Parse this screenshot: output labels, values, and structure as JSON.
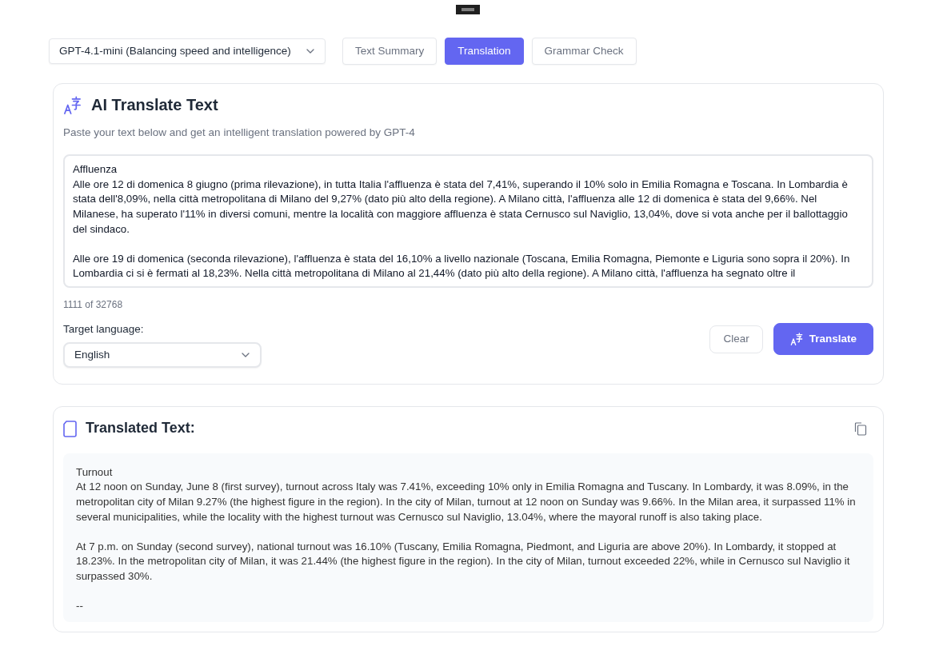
{
  "model_select": {
    "value": "GPT-4.1-mini (Balancing speed and intelligence)"
  },
  "tabs": [
    {
      "label": "Text Summary",
      "selected": false
    },
    {
      "label": "Translation",
      "selected": true
    },
    {
      "label": "Grammar Check",
      "selected": false
    }
  ],
  "translate_card": {
    "title": "AI Translate Text",
    "subtitle": "Paste your text below and get an intelligent translation powered by GPT-4",
    "input_text": "Affluenza\nAlle ore 12 di domenica 8 giugno (prima rilevazione), in tutta Italia l'affluenza è stata del 7,41%, superando il 10% solo in Emilia Romagna e Toscana. In Lombardia è stata dell'8,09%, nella città metropolitana di Milano del 9,27% (dato più alto della regione). A Milano città, l'affluenza alle 12 di domenica è stata del 9,66%. Nel Milanese, ha superato l'11% in diversi comuni, mentre la località con maggiore affluenza è stata Cernusco sul Naviglio, 13,04%, dove si vota anche per il ballottaggio del sindaco.\n\nAlle ore 19 di domenica (seconda rilevazione), l'affluenza è stata del 16,10% a livello nazionale (Toscana, Emilia Romagna, Piemonte e Liguria sono sopra il 20%). In Lombardia ci si è fermati al 18,23%. Nella città metropolitana di Milano al 21,44% (dato più alto della regione). A Milano città, l'affluenza ha segnato oltre il",
    "char_count": "1111 of 32768",
    "target_language": {
      "label": "Target language:",
      "value": "English"
    },
    "buttons": [
      {
        "label": "Clear",
        "kind": "secondary"
      },
      {
        "label": "Translate",
        "kind": "primary"
      }
    ]
  },
  "result_card": {
    "title": "Translated Text:",
    "text": "Turnout\nAt 12 noon on Sunday, June 8 (first survey), turnout across Italy was 7.41%, exceeding 10% only in Emilia Romagna and Tuscany. In Lombardy, it was 8.09%, in the metropolitan city of Milan 9.27% (the highest figure in the region). In the city of Milan, turnout at 12 noon on Sunday was 9.66%. In the Milan area, it surpassed 11% in several municipalities, while the locality with the highest turnout was Cernusco sul Naviglio, 13.04%, where the mayoral runoff is also taking place.\n\nAt 7 p.m. on Sunday (second survey), national turnout was 16.10% (Tuscany, Emilia Romagna, Piedmont, and Liguria are above 20%). In Lombardy, it stopped at 18.23%. In the metropolitan city of Milan, it was 21.44% (the highest figure in the region). In the city of Milan, turnout exceeded 22%, while in Cernusco sul Naviglio it surpassed 30%.\n\n--"
  }
}
